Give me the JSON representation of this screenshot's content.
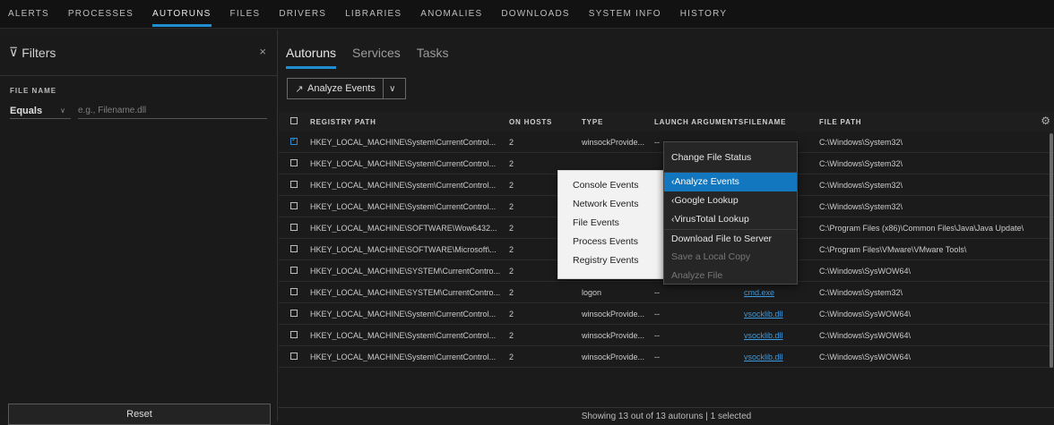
{
  "nav": [
    "ALERTS",
    "PROCESSES",
    "AUTORUNS",
    "FILES",
    "DRIVERS",
    "LIBRARIES",
    "ANOMALIES",
    "DOWNLOADS",
    "SYSTEM INFO",
    "HISTORY"
  ],
  "nav_active": "AUTORUNS",
  "filters": {
    "title": "Filters",
    "close": "×",
    "file_name_label": "FILE NAME",
    "operator": "Equals",
    "placeholder": "e.g., Filename.dll",
    "reset_label": "Reset"
  },
  "tabs": [
    "Autoruns",
    "Services",
    "Tasks"
  ],
  "analyze_label": "Analyze Events",
  "columns": [
    "REGISTRY PATH",
    "ON HOSTS",
    "TYPE",
    "LAUNCH ARGUMENTS",
    "FILENAME",
    "FILE PATH"
  ],
  "rows": [
    {
      "checked": true,
      "reg": "HKEY_LOCAL_MACHINE\\System\\CurrentControl...",
      "hosts": "2",
      "type": "winsockProvide...",
      "args": "--",
      "fname": "",
      "fpath": "C:\\Windows\\System32\\"
    },
    {
      "checked": false,
      "reg": "HKEY_LOCAL_MACHINE\\System\\CurrentControl...",
      "hosts": "2",
      "type": "",
      "args": "",
      "fname": "",
      "fpath": "C:\\Windows\\System32\\"
    },
    {
      "checked": false,
      "reg": "HKEY_LOCAL_MACHINE\\System\\CurrentControl...",
      "hosts": "2",
      "type": "",
      "args": "",
      "fname": "",
      "fpath": "C:\\Windows\\System32\\"
    },
    {
      "checked": false,
      "reg": "HKEY_LOCAL_MACHINE\\System\\CurrentControl...",
      "hosts": "2",
      "type": "",
      "args": "",
      "fname": "",
      "fpath": "C:\\Windows\\System32\\"
    },
    {
      "checked": false,
      "reg": "HKEY_LOCAL_MACHINE\\SOFTWARE\\Wow6432...",
      "hosts": "2",
      "type": "",
      "args": "",
      "fname": "",
      "fpath": "C:\\Program Files (x86)\\Common Files\\Java\\Java Update\\"
    },
    {
      "checked": false,
      "reg": "HKEY_LOCAL_MACHINE\\SOFTWARE\\Microsoft\\...",
      "hosts": "2",
      "type": "",
      "args": "",
      "fname": "",
      "fpath": "C:\\Program Files\\VMware\\VMware Tools\\"
    },
    {
      "checked": false,
      "reg": "HKEY_LOCAL_MACHINE\\SYSTEM\\CurrentContro...",
      "hosts": "2",
      "type": "logon",
      "args": "--",
      "fname": "cmd.exe",
      "fpath": "C:\\Windows\\SysWOW64\\"
    },
    {
      "checked": false,
      "reg": "HKEY_LOCAL_MACHINE\\SYSTEM\\CurrentContro...",
      "hosts": "2",
      "type": "logon",
      "args": "--",
      "fname": "cmd.exe",
      "fpath": "C:\\Windows\\System32\\"
    },
    {
      "checked": false,
      "reg": "HKEY_LOCAL_MACHINE\\System\\CurrentControl...",
      "hosts": "2",
      "type": "winsockProvide...",
      "args": "--",
      "fname": "vsocklib.dll",
      "fpath": "C:\\Windows\\SysWOW64\\"
    },
    {
      "checked": false,
      "reg": "HKEY_LOCAL_MACHINE\\System\\CurrentControl...",
      "hosts": "2",
      "type": "winsockProvide...",
      "args": "--",
      "fname": "vsocklib.dll",
      "fpath": "C:\\Windows\\SysWOW64\\"
    },
    {
      "checked": false,
      "reg": "HKEY_LOCAL_MACHINE\\System\\CurrentControl...",
      "hosts": "2",
      "type": "winsockProvide...",
      "args": "--",
      "fname": "vsocklib.dll",
      "fpath": "C:\\Windows\\SysWOW64\\"
    }
  ],
  "footer": "Showing 13 out of 13 autoruns | 1 selected",
  "submenu": [
    "Console Events",
    "Network Events",
    "File Events",
    "Process Events",
    "Registry Events"
  ],
  "context_menu": {
    "header": "Change File Status",
    "analyze": "Analyze Events",
    "google": "Google Lookup",
    "virustotal": "VirusTotal Lookup",
    "download": "Download File to Server",
    "save_local": "Save a Local Copy",
    "analyze_file": "Analyze File"
  },
  "colors": {
    "accent": "#1f8fd1",
    "link": "#3b9ae0",
    "highlight": "#1277bf"
  }
}
